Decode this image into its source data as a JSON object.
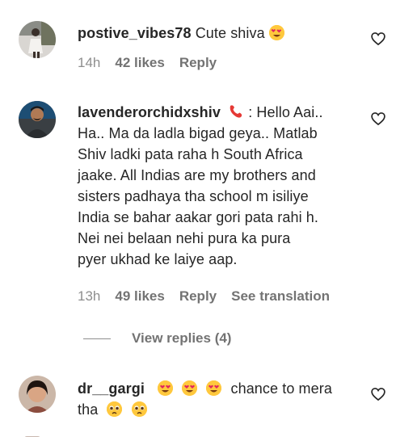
{
  "comments": [
    {
      "username": "postive_vibes78",
      "text": "Cute shiva",
      "emoji_after": "heart-eyes-emoji",
      "time": "14h",
      "likes": "42 likes",
      "reply": "Reply",
      "avatar": "user-avatar"
    },
    {
      "username": "lavenderorchidxshiv",
      "phone_icon": "telephone-receiver-emoji",
      "line1_rest": ": Hello Aai..",
      "lines": [
        "Ha.. Ma da ladla bigad geya.. Matlab",
        "Shiv ladki pata raha h South Africa",
        "jaake. All Indias are my brothers and",
        "sisters padhaya tha school m isiliye",
        "India se bahar aakar gori pata rahi h.",
        "Nei nei belaan nehi pura ka pura",
        "pyer ukhad ke laiye aap."
      ],
      "time": "13h",
      "likes": "49 likes",
      "reply": "Reply",
      "translation": "See translation",
      "avatar": "user-avatar"
    },
    {
      "username": "dr__gargi",
      "text": "chance to mera",
      "text2": "tha",
      "emojis": [
        "heart-eyes-emoji",
        "heart-eyes-emoji",
        "heart-eyes-emoji"
      ],
      "sad_emojis": [
        "pleading-face-emoji",
        "pleading-face-emoji"
      ],
      "avatar": "user-avatar"
    }
  ],
  "view_replies": "View replies (4)",
  "colors": {
    "text": "#262626",
    "muted": "#8e8e8e",
    "emoji": "#ffc83d",
    "heart_red": "#e0245e",
    "phone_red": "#e53935"
  }
}
